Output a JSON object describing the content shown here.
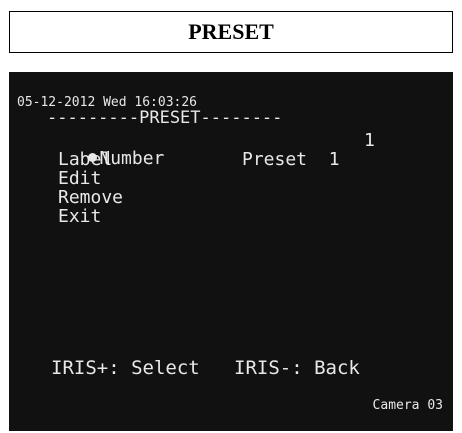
{
  "title": "PRESET",
  "osd": {
    "datetime": "05-12-2012 Wed 16:03:26",
    "menu_header": "---------PRESET--------",
    "items": [
      {
        "label": "Number",
        "value": "1"
      },
      {
        "label": "Label",
        "value": "Preset  1"
      },
      {
        "label": "Edit",
        "value": ""
      },
      {
        "label": "Remove",
        "value": ""
      },
      {
        "label": "Exit",
        "value": ""
      }
    ],
    "hint_select": "IRIS+: Select",
    "hint_back": "IRIS-: Back",
    "camera": "Camera 03"
  },
  "colors": {
    "screen_bg": "#111111",
    "osd_text": "#e8e8e8"
  }
}
